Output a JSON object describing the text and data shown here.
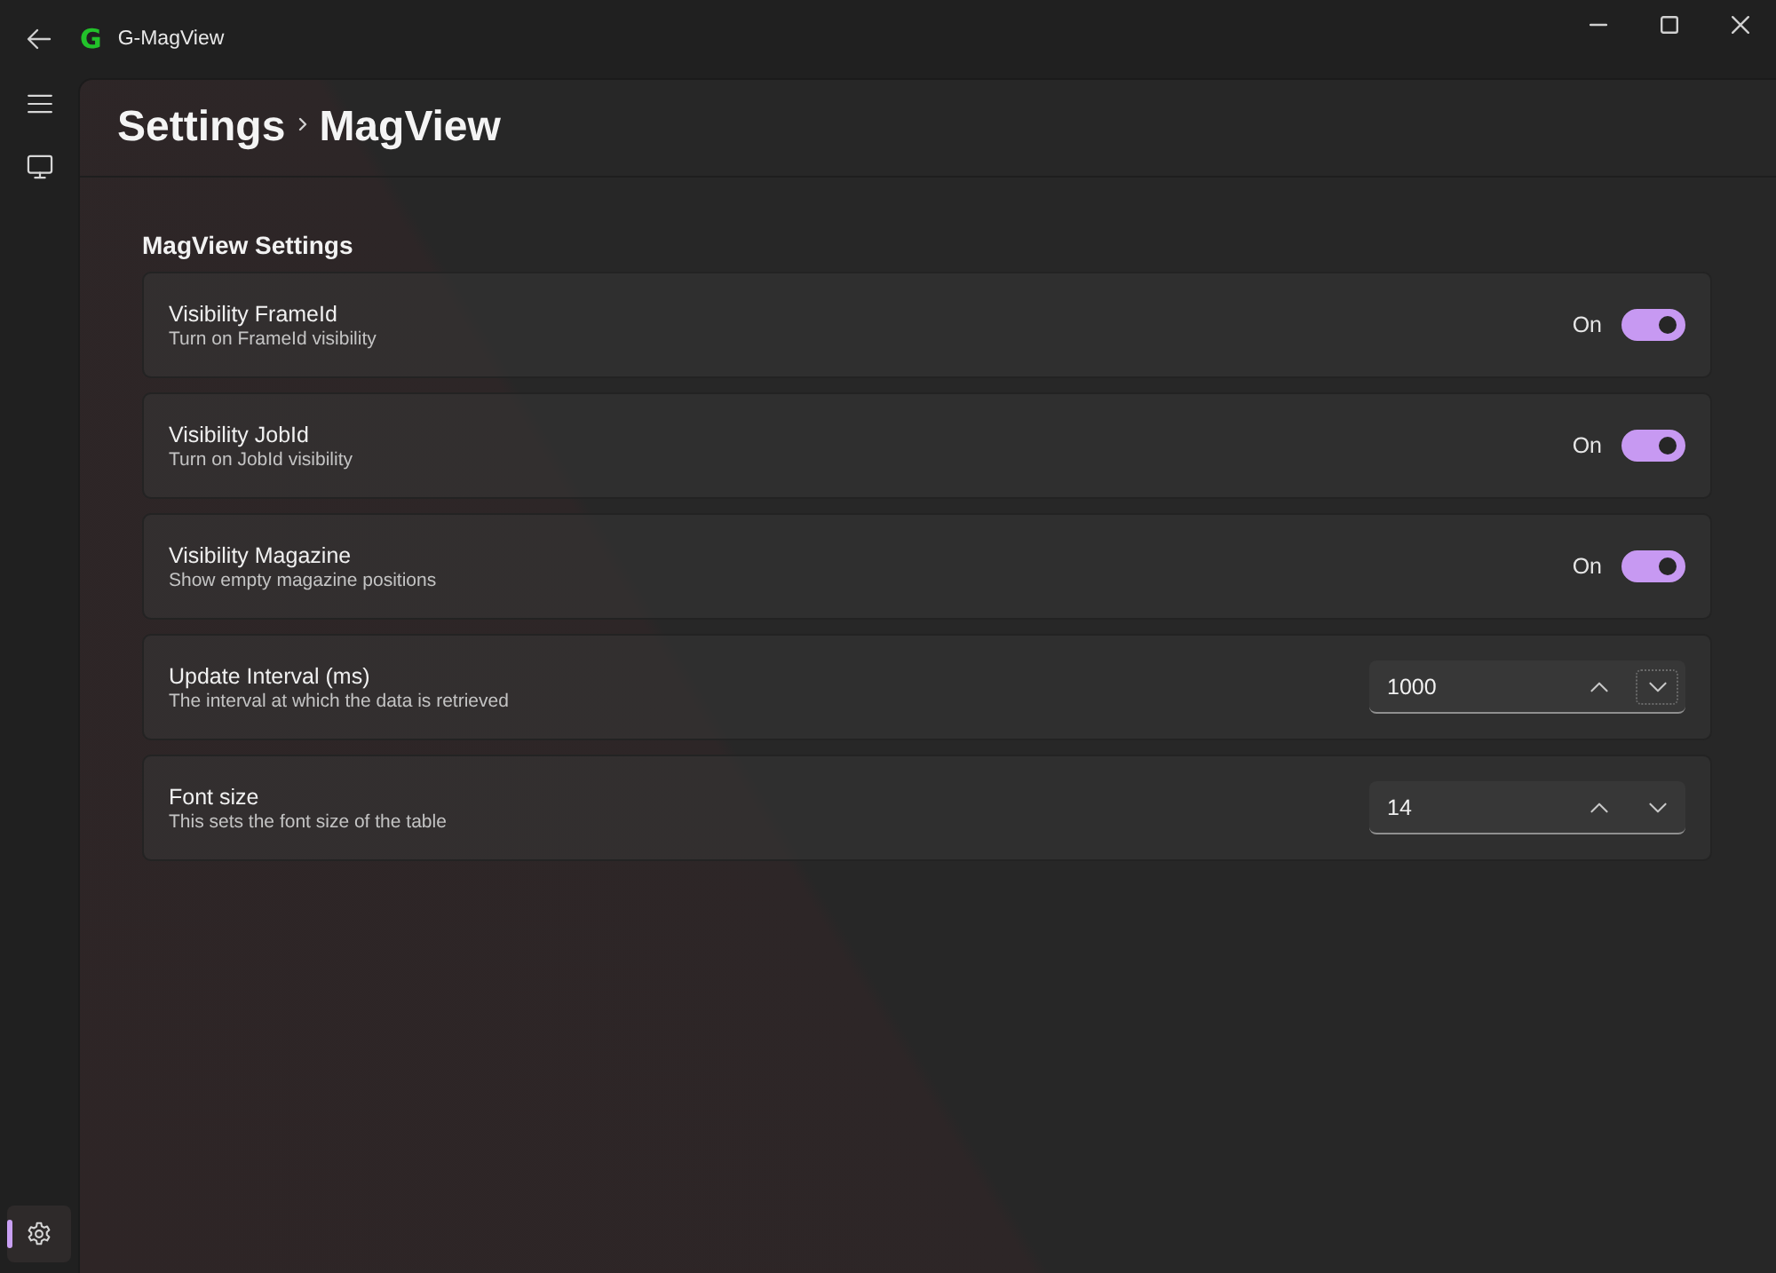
{
  "window": {
    "title": "G-MagView",
    "logo": "G"
  },
  "nav": {
    "items": [
      {
        "kind": "monitor",
        "selected": false
      }
    ],
    "footer_items": [
      {
        "kind": "settings",
        "selected": true
      }
    ]
  },
  "header": {
    "breadcrumb": [
      "Settings",
      "MagView"
    ]
  },
  "section": {
    "title": "MagView Settings",
    "settings": [
      {
        "kind": "toggle",
        "title": "Visibility FrameId",
        "description": "Turn on FrameId visibility",
        "state_label": "On",
        "on": true
      },
      {
        "kind": "toggle",
        "title": "Visibility JobId",
        "description": "Turn on JobId visibility",
        "state_label": "On",
        "on": true
      },
      {
        "kind": "toggle",
        "title": "Visibility Magazine",
        "description": "Show empty magazine positions",
        "state_label": "On",
        "on": true
      },
      {
        "kind": "number",
        "title": "Update Interval (ms)",
        "description": "The interval at which the data is retrieved",
        "value": "1000",
        "down_focused": true
      },
      {
        "kind": "number",
        "title": "Font size",
        "description": "This sets the font size of the table",
        "value": "14",
        "down_focused": false
      }
    ]
  }
}
